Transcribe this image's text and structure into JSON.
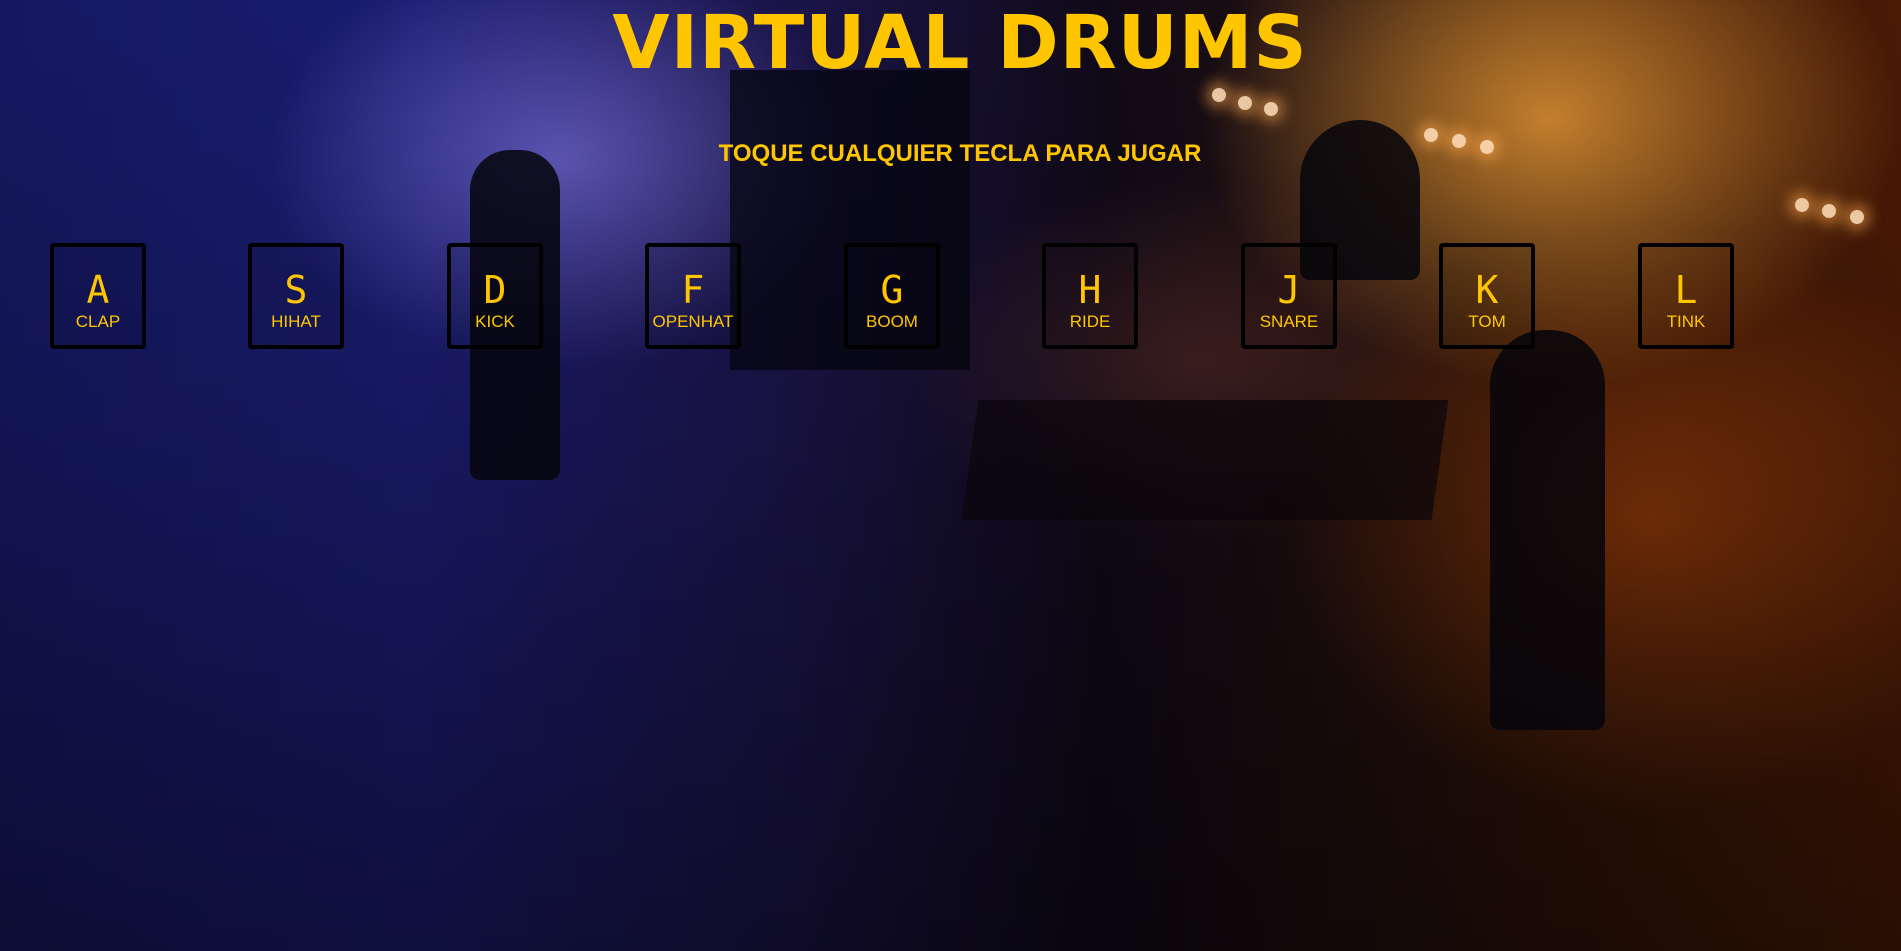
{
  "page": {
    "title": "VIRTUAL DRUMS",
    "subtitle": "TOQUE CUALQUIER TECLA PARA JUGAR"
  },
  "colors": {
    "accent": "#ffc600",
    "key_border": "#000000"
  },
  "keys": [
    {
      "letter": "A",
      "sound": "CLAP"
    },
    {
      "letter": "S",
      "sound": "HIHAT"
    },
    {
      "letter": "D",
      "sound": "KICK"
    },
    {
      "letter": "F",
      "sound": "OPENHAT"
    },
    {
      "letter": "G",
      "sound": "BOOM"
    },
    {
      "letter": "H",
      "sound": "RIDE"
    },
    {
      "letter": "J",
      "sound": "SNARE"
    },
    {
      "letter": "K",
      "sound": "TOM"
    },
    {
      "letter": "L",
      "sound": "TINK"
    }
  ]
}
